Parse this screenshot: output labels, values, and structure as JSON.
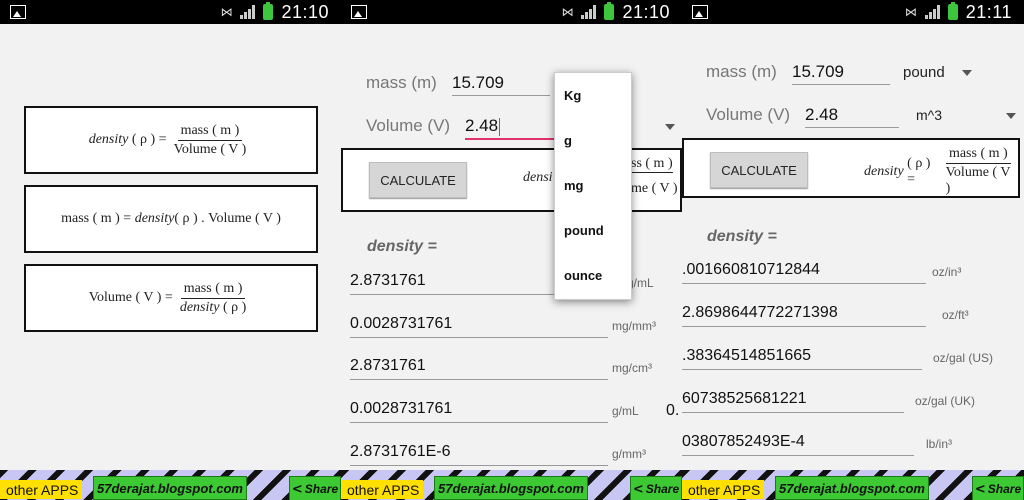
{
  "status": {
    "icons": [
      "image-icon",
      "mute-icon",
      "signal-icon",
      "battery-icon"
    ],
    "times": [
      "21:10",
      "21:10",
      "21:11"
    ]
  },
  "screen1": {
    "formula1": {
      "lhs": "density",
      "sym": "( ρ ) =",
      "num": "mass ( m )",
      "den": "Volume ( V )"
    },
    "formula2": {
      "text_a": "mass ( m ) = ",
      "text_b": "density",
      "text_c": " ( ρ ) . Volume ( V )"
    },
    "formula3": {
      "lhs": "Volume ( V ) =",
      "num": "mass ( m )",
      "den_a": "density",
      "den_b": " ( ρ )"
    }
  },
  "screen2": {
    "mass_label": "mass (m)",
    "mass_value": "15.709",
    "volume_label": "Volume (V)",
    "volume_value": "2.48",
    "calculate": "CALCULATE",
    "formula_partial": "densi",
    "frac_num_partial": "ss ( m )",
    "frac_den_partial": "me ( V )",
    "density_label": "density  =",
    "dropdown_options": [
      "Kg",
      "g",
      "mg",
      "pound",
      "ounce"
    ],
    "results": [
      {
        "value": "2.8731761",
        "unit": "g/mL"
      },
      {
        "value": "0.0028731761",
        "unit": "mg/mm³"
      },
      {
        "value": "2.8731761",
        "unit": "mg/cm³"
      },
      {
        "value": "0.0028731761",
        "unit": "g/mL"
      },
      {
        "value": "2.8731761E-6",
        "unit": "g/mm³"
      }
    ],
    "edge_char": "0."
  },
  "screen3": {
    "mass_label": "mass (m)",
    "mass_value": "15.709",
    "mass_unit": "pound",
    "volume_label": "Volume (V)",
    "volume_value": "2.48",
    "volume_unit": "m^3",
    "calculate": "CALCULATE",
    "formula": {
      "lhs": "density",
      "sym": "( ρ ) =",
      "num": "mass ( m )",
      "den": "Volume ( V )"
    },
    "density_label": "density  =",
    "results": [
      {
        "value": ".001660810712844",
        "unit": "oz/in³"
      },
      {
        "value": "2.8698644772271398",
        "unit": "oz/ft³"
      },
      {
        "value": ".38364514851665",
        "unit": "oz/gal (US)"
      },
      {
        "value": "60738525681221",
        "unit": "oz/gal (UK)"
      },
      {
        "value": "03807852493E-4",
        "unit": "lb/in³"
      }
    ]
  },
  "bottom": {
    "other_apps": "other APPS",
    "blog": "57derajat.blogspot.com",
    "share": "Share"
  }
}
